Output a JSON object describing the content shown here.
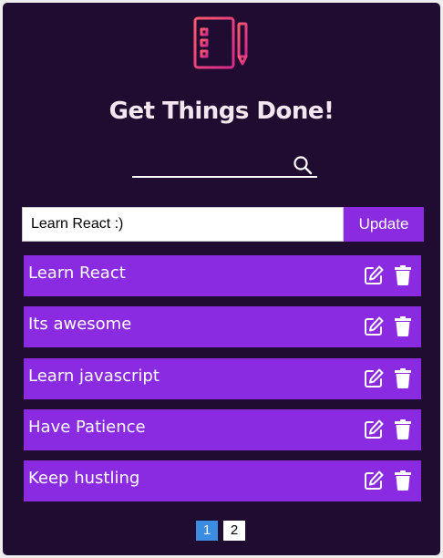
{
  "header": {
    "logo_icon": "checklist-clipboard-pencil-icon",
    "title": "Get Things Done!"
  },
  "search": {
    "value": "",
    "placeholder": "",
    "icon": "search-icon"
  },
  "editor": {
    "input_value": "Learn React :)",
    "button_label": "Update"
  },
  "todos": [
    {
      "text": "Learn React"
    },
    {
      "text": "Its awesome"
    },
    {
      "text": "Learn javascript"
    },
    {
      "text": "Have Patience"
    },
    {
      "text": "Keep hustling"
    }
  ],
  "item_icons": {
    "edit": "edit-icon",
    "delete": "trash-icon"
  },
  "pagination": {
    "pages": [
      "1",
      "2"
    ],
    "current": "1"
  },
  "colors": {
    "background": "#1f0c30",
    "accent": "#8a2be2",
    "title": "#f3e6ee",
    "logo_gradient_start": "#ff4f7b",
    "logo_gradient_end": "#d8308b",
    "page_active": "#3a8de0"
  }
}
